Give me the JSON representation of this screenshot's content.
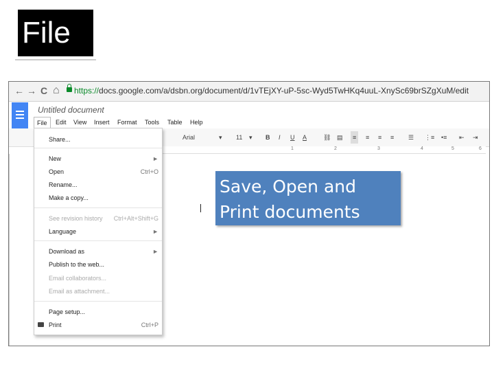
{
  "slide": {
    "title": "File"
  },
  "browser": {
    "back": "←",
    "forward": "→",
    "reload": "C",
    "home": "⌂",
    "url_scheme": "https://",
    "url_rest": "docs.google.com/a/dsbn.org/document/d/1vTEjXY-uP-5sc-Wyd5TwHKq4uuL-XnySc69brSZgXuM/edit"
  },
  "docs": {
    "document_title": "Untitled document",
    "menu": [
      "File",
      "Edit",
      "View",
      "Insert",
      "Format",
      "Tools",
      "Table",
      "Help"
    ],
    "toolbar": {
      "font": "Arial",
      "font_dropdown": "▾",
      "size": "11",
      "size_dropdown": "▾",
      "bold": "B",
      "italic": "I",
      "underline": "U",
      "text_color": "A",
      "link": "⛓",
      "comment": "▤",
      "align_left": "≡",
      "align_center": "≡",
      "align_right": "≡",
      "justify": "≡",
      "line_spacing": "☰",
      "numbered_list": "⋮≡",
      "bulleted_list": "•≡",
      "decrease_indent": "⇤",
      "increase_indent": "⇥"
    },
    "ruler": [
      "1",
      "2",
      "3",
      "4",
      "5",
      "6"
    ],
    "file_menu": [
      {
        "label": "Share...",
        "shortcut": "",
        "disabled": false
      },
      {
        "label": "New",
        "shortcut": "►",
        "disabled": false
      },
      {
        "label": "Open",
        "shortcut": "Ctrl+O",
        "disabled": false
      },
      {
        "label": "Rename...",
        "shortcut": "",
        "disabled": false
      },
      {
        "label": "Make a copy...",
        "shortcut": "",
        "disabled": false
      },
      {
        "label": "See revision history",
        "shortcut": "Ctrl+Alt+Shift+G",
        "disabled": true
      },
      {
        "label": "Language",
        "shortcut": "►",
        "disabled": false
      },
      {
        "label": "Download as",
        "shortcut": "►",
        "disabled": false
      },
      {
        "label": "Publish to the web...",
        "shortcut": "",
        "disabled": false
      },
      {
        "label": "Email collaborators...",
        "shortcut": "",
        "disabled": true
      },
      {
        "label": "Email as attachment...",
        "shortcut": "",
        "disabled": true
      },
      {
        "label": "Page setup...",
        "shortcut": "",
        "disabled": false
      },
      {
        "label": "Print",
        "shortcut": "Ctrl+P",
        "disabled": false
      }
    ]
  },
  "callout": {
    "line1": "Save, Open and",
    "line2": "Print documents"
  }
}
